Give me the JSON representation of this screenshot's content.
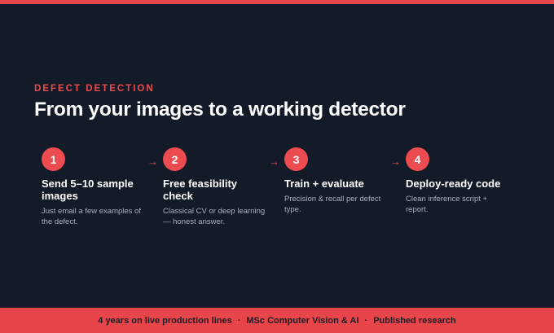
{
  "eyebrow": "DEFECT DETECTION",
  "headline": "From your images to a working detector",
  "steps": [
    {
      "num": "1",
      "title": "Send 5–10 sample images",
      "desc": "Just email a few examples of the defect."
    },
    {
      "num": "2",
      "title": "Free feasibility check",
      "desc": "Classical CV or deep learning — honest answer."
    },
    {
      "num": "3",
      "title": "Train + evaluate",
      "desc": "Precision & recall per defect type."
    },
    {
      "num": "4",
      "title": "Deploy-ready code",
      "desc": "Clean inference script + report."
    }
  ],
  "arrow": "→",
  "footer": {
    "items": [
      "4 years on live production lines",
      "MSc Computer Vision & AI",
      "Published research"
    ],
    "separator": "·"
  },
  "colors": {
    "background": "#131a28",
    "accent": "#e8454a",
    "text": "#ffffff",
    "muted": "#a9afbb"
  }
}
